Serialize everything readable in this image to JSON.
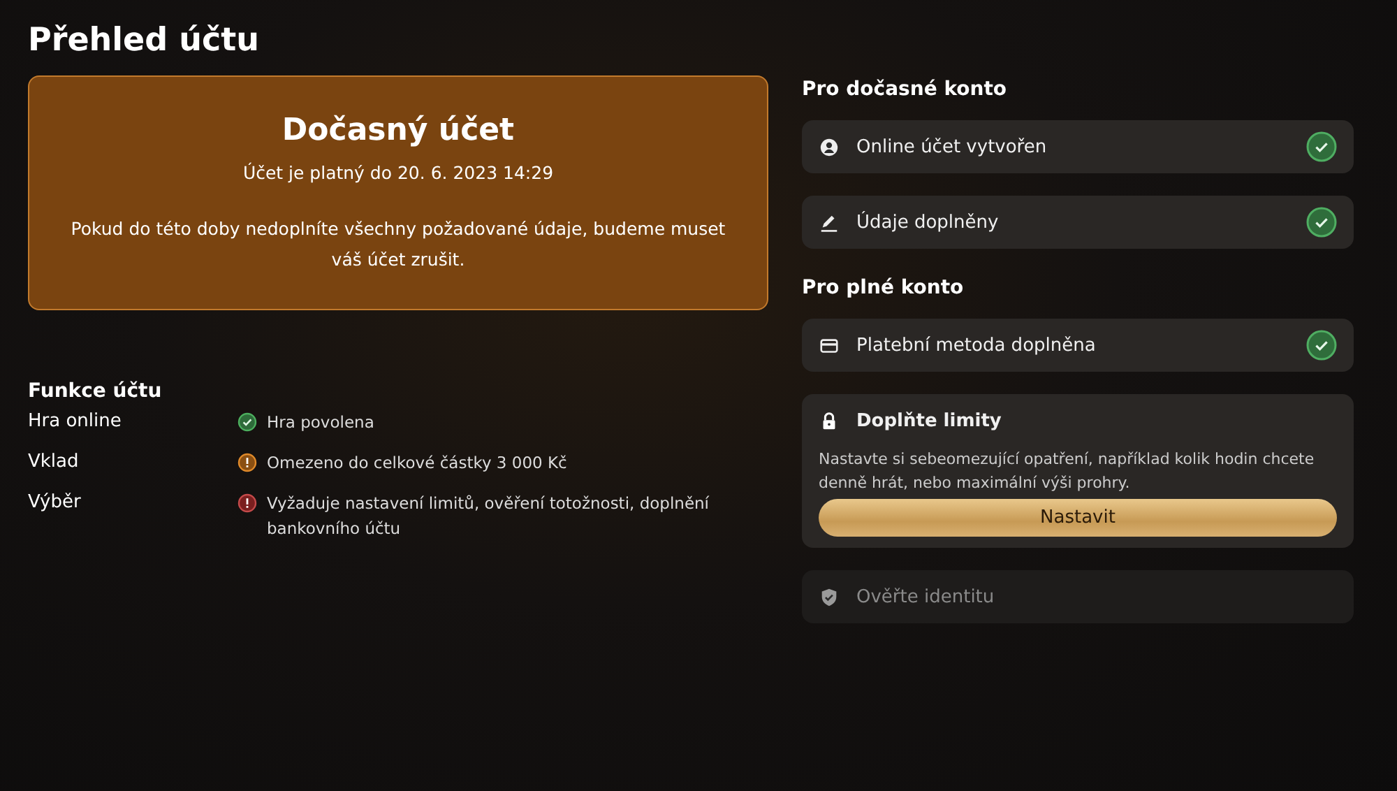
{
  "title": "Přehled účtu",
  "notice": {
    "title": "Dočasný účet",
    "validity": "Účet je platný do 20. 6. 2023 14:29",
    "message": "Pokud do této doby nedoplníte všechny požadované údaje, budeme muset váš účet zrušit."
  },
  "features": {
    "heading": "Funkce účtu",
    "rows": [
      {
        "label": "Hra online",
        "kind": "ok",
        "value": "Hra povolena"
      },
      {
        "label": "Vklad",
        "kind": "warning",
        "value": "Omezeno do celkové částky 3 000 Kč"
      },
      {
        "label": "Výběr",
        "kind": "blocked",
        "value": "Vyžaduje nastavení limitů, ověření totožnosti, doplnění bankovního účtu"
      }
    ]
  },
  "sections": [
    {
      "heading": "Pro dočasné konto",
      "steps": [
        {
          "kind": "item",
          "label": "Online účet vytvořen",
          "done": true,
          "disabled": false
        },
        {
          "kind": "item",
          "label": "Údaje doplněny",
          "done": true,
          "disabled": false
        }
      ]
    },
    {
      "heading": "Pro plné konto",
      "steps": [
        {
          "kind": "item",
          "label": "Platební metoda doplněna",
          "done": true,
          "disabled": false
        },
        {
          "kind": "action",
          "label": "Doplňte limity",
          "description": "Nastavte si sebeomezující opatření, například kolik hodin chcete denně hrát, nebo maximální výši prohry.",
          "button": "Nastavit"
        },
        {
          "kind": "item",
          "label": "Ověřte identitu",
          "done": false,
          "disabled": true
        }
      ]
    }
  ]
}
